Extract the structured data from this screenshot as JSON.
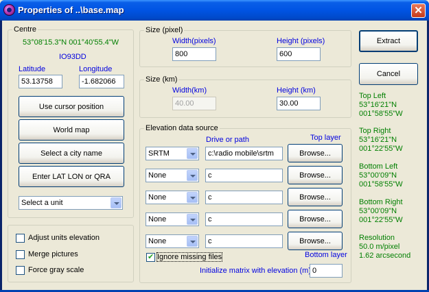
{
  "window": {
    "title": "Properties of ..\\base.map",
    "close_glyph": "✕"
  },
  "centre": {
    "group_label": "Centre",
    "coords": "53°08'15.3\"N 001°40'55.4\"W",
    "locator": "IO93DD",
    "latitude_label": "Latitude",
    "longitude_label": "Longitude",
    "latitude_value": "53.13758",
    "longitude_value": "-1.682066",
    "buttons": {
      "cursor": "Use cursor position",
      "world_map": "World map",
      "city": "Select a city name",
      "enter_lat_lon": "Enter LAT LON or QRA"
    },
    "unit_select": "Select a unit"
  },
  "options": {
    "adjust_units": "Adjust units elevation",
    "merge_pictures": "Merge pictures",
    "gray_scale": "Force gray scale"
  },
  "size_pixel": {
    "group_label": "Size (pixel)",
    "width_label": "Width(pixels)",
    "height_label": "Height (pixels)",
    "width_value": "800",
    "height_value": "600"
  },
  "size_km": {
    "group_label": "Size (km)",
    "width_label": "Width(km)",
    "height_label": "Height (km)",
    "width_value": "40.00",
    "height_value": "30.00"
  },
  "elevation": {
    "group_label": "Elevation data source",
    "drive_label": "Drive or path",
    "top_layer_label": "Top layer",
    "bottom_layer_label": "Bottom layer",
    "browse_label": "Browse...",
    "rows": [
      {
        "source": "SRTM",
        "path": "c:\\radio mobile\\srtm"
      },
      {
        "source": "None",
        "path": "c"
      },
      {
        "source": "None",
        "path": "c"
      },
      {
        "source": "None",
        "path": "c"
      },
      {
        "source": "None",
        "path": "c"
      }
    ],
    "ignore_missing": "Ignore missing files",
    "init_matrix_label": "Initialize matrix with elevation (m)",
    "init_matrix_value": "0"
  },
  "actions": {
    "extract": "Extract",
    "cancel": "Cancel"
  },
  "info": {
    "top_left_title": "Top Left",
    "top_left_lat": "53°16'21\"N",
    "top_left_lon": "001°58'55\"W",
    "top_right_title": "Top Right",
    "top_right_lat": "53°16'21\"N",
    "top_right_lon": "001°22'55\"W",
    "bottom_left_title": "Bottom Left",
    "bottom_left_lat": "53°00'09\"N",
    "bottom_left_lon": "001°58'55\"W",
    "bottom_right_title": "Bottom Right",
    "bottom_right_lat": "53°00'09\"N",
    "bottom_right_lon": "001°22'55\"W",
    "resolution_title": "Resolution",
    "resolution_m": "50.0 m/pixel",
    "resolution_arc": "1.62 arcsecond"
  },
  "colors": {
    "title_bar": "#0054e3",
    "info_text": "#007f00",
    "label_blue": "#0000e0",
    "face": "#ece9d8"
  }
}
